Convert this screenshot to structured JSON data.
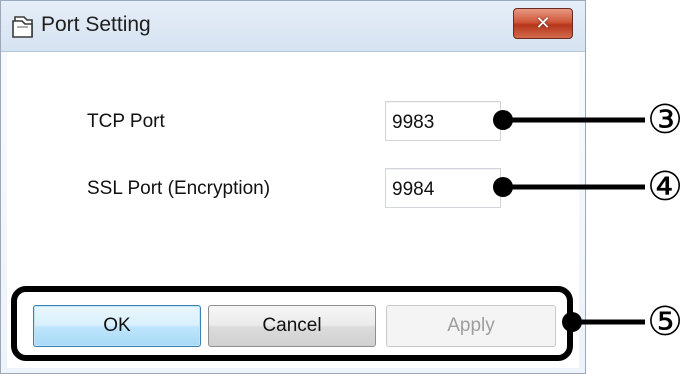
{
  "window": {
    "title": "Port Setting",
    "close_symbol": "✕",
    "icon": "folder-icon"
  },
  "fields": {
    "tcp": {
      "label": "TCP Port",
      "value": "9983"
    },
    "ssl": {
      "label": "SSL Port (Encryption)",
      "value": "9984"
    }
  },
  "buttons": {
    "ok": "OK",
    "cancel": "Cancel",
    "apply": "Apply"
  },
  "callouts": {
    "tcp": "③",
    "ssl": "④",
    "buttons": "⑤"
  },
  "colors": {
    "close_button": "#c9452a",
    "default_button_border": "#3c7fb1",
    "annotation": "#000000"
  }
}
